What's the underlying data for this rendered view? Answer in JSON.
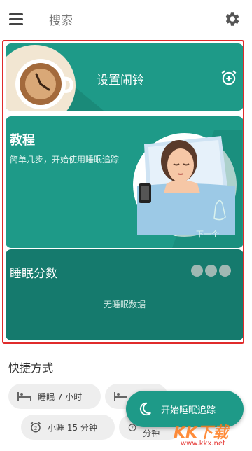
{
  "topbar": {
    "search_placeholder": "搜索"
  },
  "alarm_card": {
    "title": "设置闹铃"
  },
  "tutorial_card": {
    "title": "教程",
    "description": "简单几步，开始使用睡眠追踪",
    "next_label": "下一个"
  },
  "sleep_score_card": {
    "title": "睡眠分数",
    "empty_text": "无睡眠数据"
  },
  "shortcuts": {
    "title": "快捷方式",
    "items": [
      {
        "label": "睡眠 7 小时",
        "icon": "bed-icon"
      },
      {
        "label": "",
        "icon": "bed-icon"
      },
      {
        "label": "小睡 15 分钟",
        "icon": "alarm-clock-icon"
      },
      {
        "label": "小睡 30 分钟",
        "icon": "alarm-clock-icon"
      }
    ]
  },
  "fab": {
    "label": "开始睡眠追踪",
    "icon": "moon-icon"
  },
  "watermark": {
    "logo": "KK下载",
    "url": "www.kkx.net"
  },
  "colors": {
    "accent": "#1e9a88",
    "accent_dark": "#157a6d",
    "highlight_frame": "#e02b2b"
  }
}
